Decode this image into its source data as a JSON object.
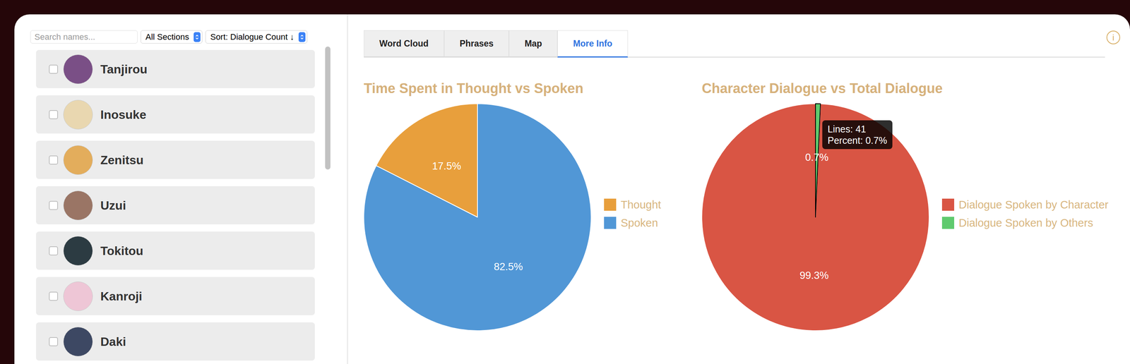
{
  "sidebar": {
    "search": {
      "placeholder": "Search names..."
    },
    "filters": [
      {
        "label": "All Sections"
      },
      {
        "label": "Sort: Dialogue Count ↓"
      }
    ],
    "characters": [
      {
        "name": "Tanjirou",
        "checked": false,
        "color": "#7a4f86"
      },
      {
        "name": "Inosuke",
        "checked": false,
        "color": "#e9d7b0"
      },
      {
        "name": "Zenitsu",
        "checked": false,
        "color": "#e3ad5c"
      },
      {
        "name": "Uzui",
        "checked": false,
        "color": "#9a7565"
      },
      {
        "name": "Tokitou",
        "checked": false,
        "color": "#2c3b42"
      },
      {
        "name": "Kanroji",
        "checked": false,
        "color": "#eec6d6"
      },
      {
        "name": "Daki",
        "checked": false,
        "color": "#3d4863"
      }
    ]
  },
  "tabs": [
    {
      "label": "Word Cloud",
      "selected": false
    },
    {
      "label": "Phrases",
      "selected": false
    },
    {
      "label": "Map",
      "selected": false
    },
    {
      "label": "More Info",
      "selected": true
    }
  ],
  "info_icon": "i",
  "charts": [
    {
      "title": "Time Spent in Thought vs Spoken",
      "values": [
        17.5,
        82.5
      ],
      "value_labels": [
        "17.5%",
        "82.5%"
      ],
      "legend": [
        {
          "label": "Thought",
          "color": "#e89f3c",
          "hovered": false
        },
        {
          "label": "Spoken",
          "color": "#5197d6",
          "hovered": false
        }
      ],
      "tooltip": null
    },
    {
      "title": "Character Dialogue vs Total Dialogue",
      "values": [
        99.3,
        0.7
      ],
      "value_labels": [
        "99.3%",
        "0.7%"
      ],
      "legend": [
        {
          "label": "Dialogue Spoken by Character",
          "color": "#d95544",
          "hovered": false
        },
        {
          "label": "Dialogue Spoken by Others",
          "color": "#5fca6e",
          "hovered": true
        }
      ],
      "tooltip": {
        "lines": [
          "Lines: 41",
          "Percent: 0.7%"
        ]
      }
    }
  ]
}
